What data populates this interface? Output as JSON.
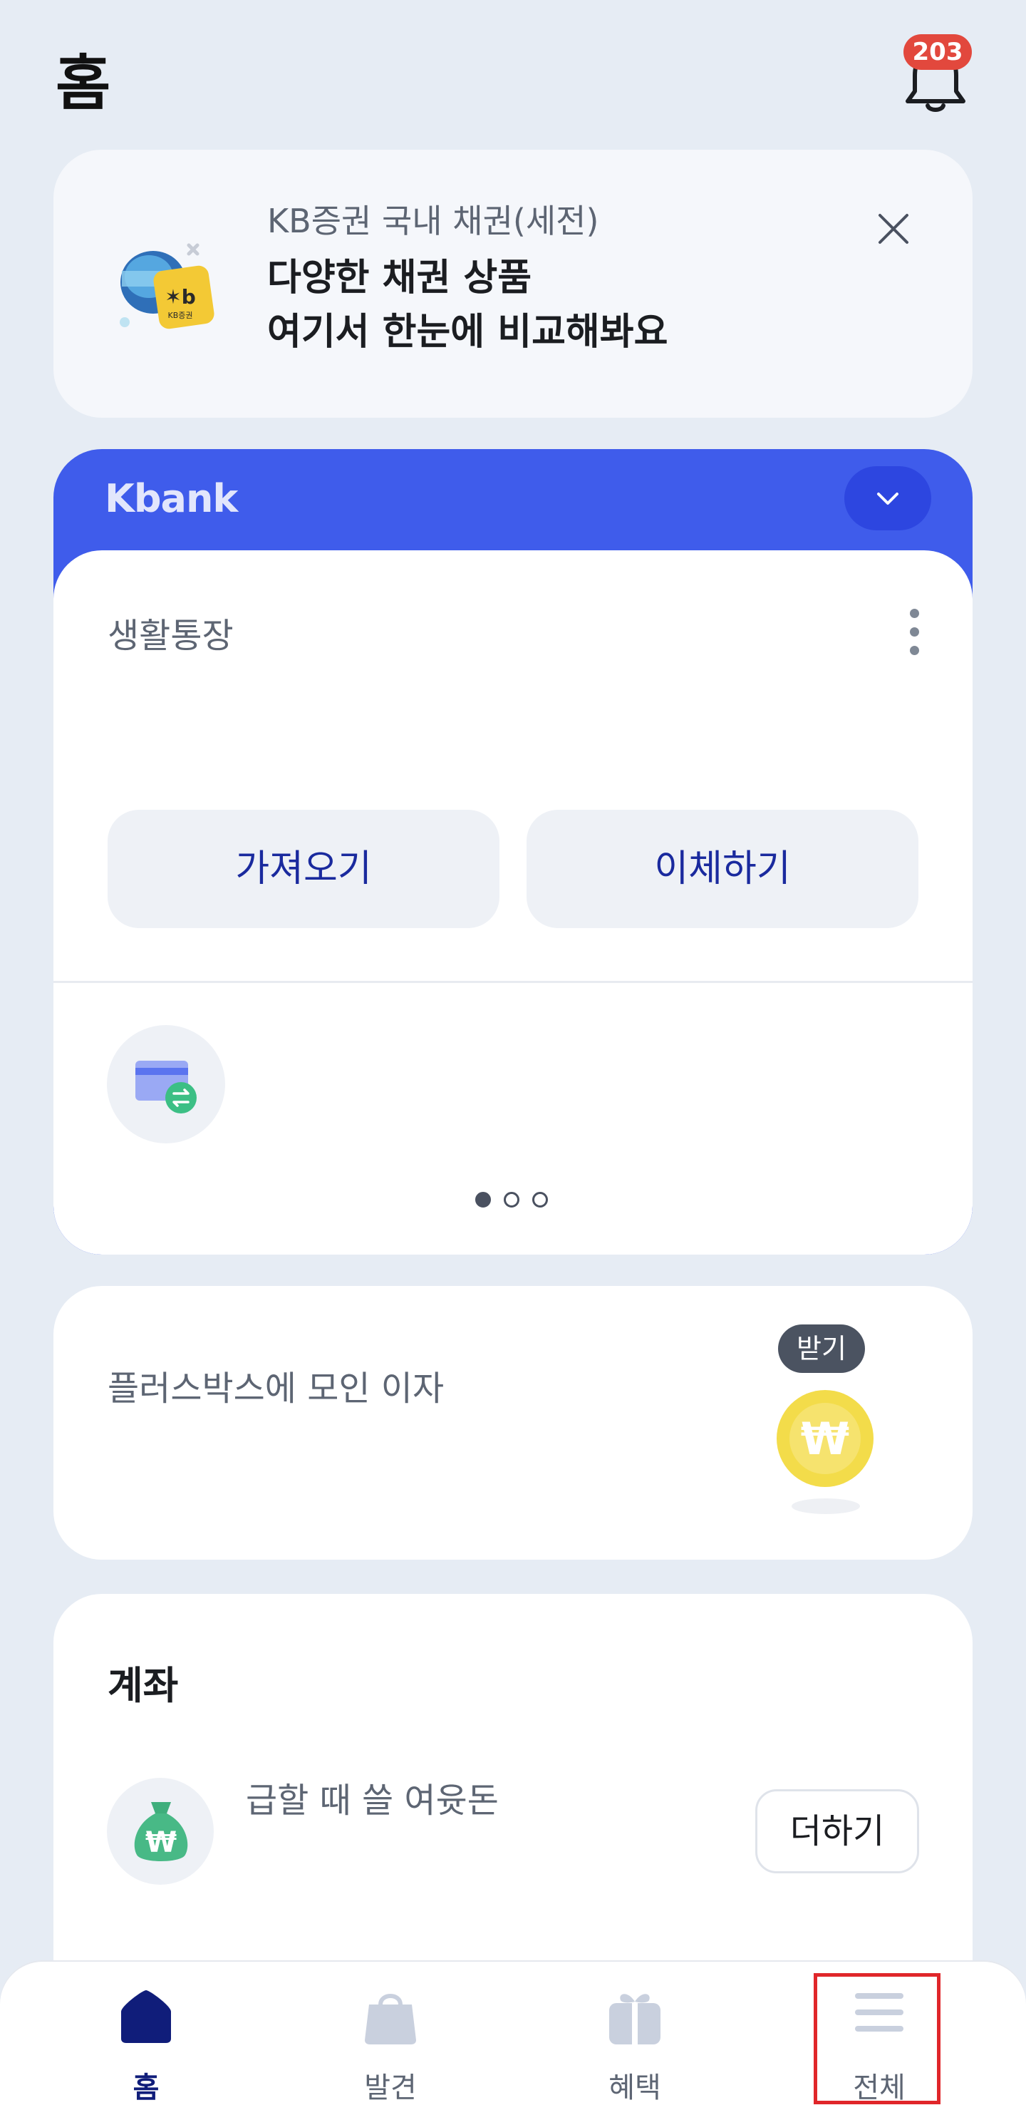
{
  "header": {
    "title": "홈",
    "notification_count": "203"
  },
  "promo": {
    "subtitle": "KB증권 국내 채권(세전)",
    "title_line1": "다양한 채권 상품",
    "title_line2": "여기서 한눈에 비교해봐요",
    "icon_text": "KB증권"
  },
  "bank_card": {
    "logo": "Kbank",
    "account_name": "생활통장",
    "buttons": [
      "가져오기",
      "이체하기"
    ],
    "pagination_total": 3,
    "pagination_active": 1,
    "brand_color": "#3f5ceb"
  },
  "plus_box": {
    "text": "플러스박스에 모인 이자",
    "receive_label": "받기",
    "coin_symbol": "₩"
  },
  "accounts": {
    "title": "계좌",
    "item_label": "급할 때 쓸 여윳돈",
    "add_label": "더하기",
    "bag_symbol": "₩"
  },
  "tabs": [
    {
      "label": "홈",
      "icon": "home-icon",
      "active": true
    },
    {
      "label": "발견",
      "icon": "shopping-bag-icon",
      "active": false
    },
    {
      "label": "혜택",
      "icon": "gift-icon",
      "active": false
    },
    {
      "label": "전체",
      "icon": "menu-icon",
      "active": false
    }
  ],
  "colors": {
    "active_tab": "#101d7a",
    "button_text": "#1a2a9e",
    "badge": "#e2483d",
    "highlight": "#e0262a"
  }
}
